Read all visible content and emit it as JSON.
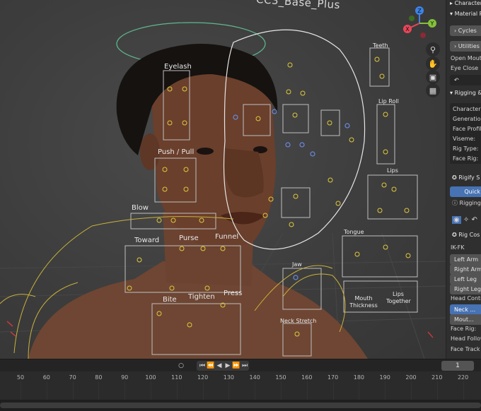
{
  "viewport": {
    "labels": {
      "title": "CC3_Base_Plus",
      "eyelash": "Eyelash",
      "push_pull": "Push / Pull",
      "blow": "Blow",
      "toward": "Toward",
      "purse": "Purse",
      "funnel": "Funnel",
      "bite": "Bite",
      "tighten": "Tighten",
      "press": "Press",
      "teeth": "Teeth",
      "lip_roll": "Lip Roll",
      "lips": "Lips",
      "tongue": "Tongue",
      "jaw": "Jaw",
      "mouth_thickness": "Mouth Thickness",
      "lips_together": "Lips Together",
      "neck_stretch": "Neck Stretch"
    },
    "gizmo": {
      "axes": [
        "Z",
        "X",
        "Y"
      ],
      "colors": {
        "x": "#e8465a",
        "y": "#84c23a",
        "z": "#3c83e6"
      }
    },
    "nav_icons": [
      "zoom-icon",
      "hand-icon",
      "camera-icon",
      "grid-icon"
    ]
  },
  "npanel": {
    "character_header": "Character",
    "material_header": "Material Pa",
    "cycles_label": "Cycles",
    "utilities_label": "Utilities",
    "open_mouth": "Open Mouth",
    "eye_close": "Eye Close",
    "rigging_header": "Rigging & A",
    "character_field": "Character:",
    "generation_field": "Generation:",
    "face_profile_field": "Face Profile:",
    "viseme_field": "Viseme:",
    "rig_type_field": "Rig Type:",
    "face_rig_field": "Face Rig:",
    "rigify_header": "Rigify S",
    "quick_button": "Quick",
    "rigging_label": "Rigging",
    "rig_controls_header": "Rig Cos",
    "ik_fk_label": "IK-FK",
    "left_arm": "Left Arm",
    "right_arm": "Right Arm",
    "left_leg": "Left Leg",
    "right_leg": "Right Leg",
    "head_control_label": "Head Contro",
    "neck_button": "Neck ...",
    "mouth_button": "Mout...",
    "face_rig_label": "Face Rig:",
    "head_follow_label": "Head Follow",
    "face_track_label": "Face Track"
  },
  "timeline": {
    "current_frame": "1",
    "ticks": [
      "50",
      "60",
      "70",
      "80",
      "90",
      "100",
      "110",
      "120",
      "130",
      "140",
      "150",
      "160",
      "170",
      "180",
      "190",
      "200",
      "210",
      "220"
    ]
  }
}
